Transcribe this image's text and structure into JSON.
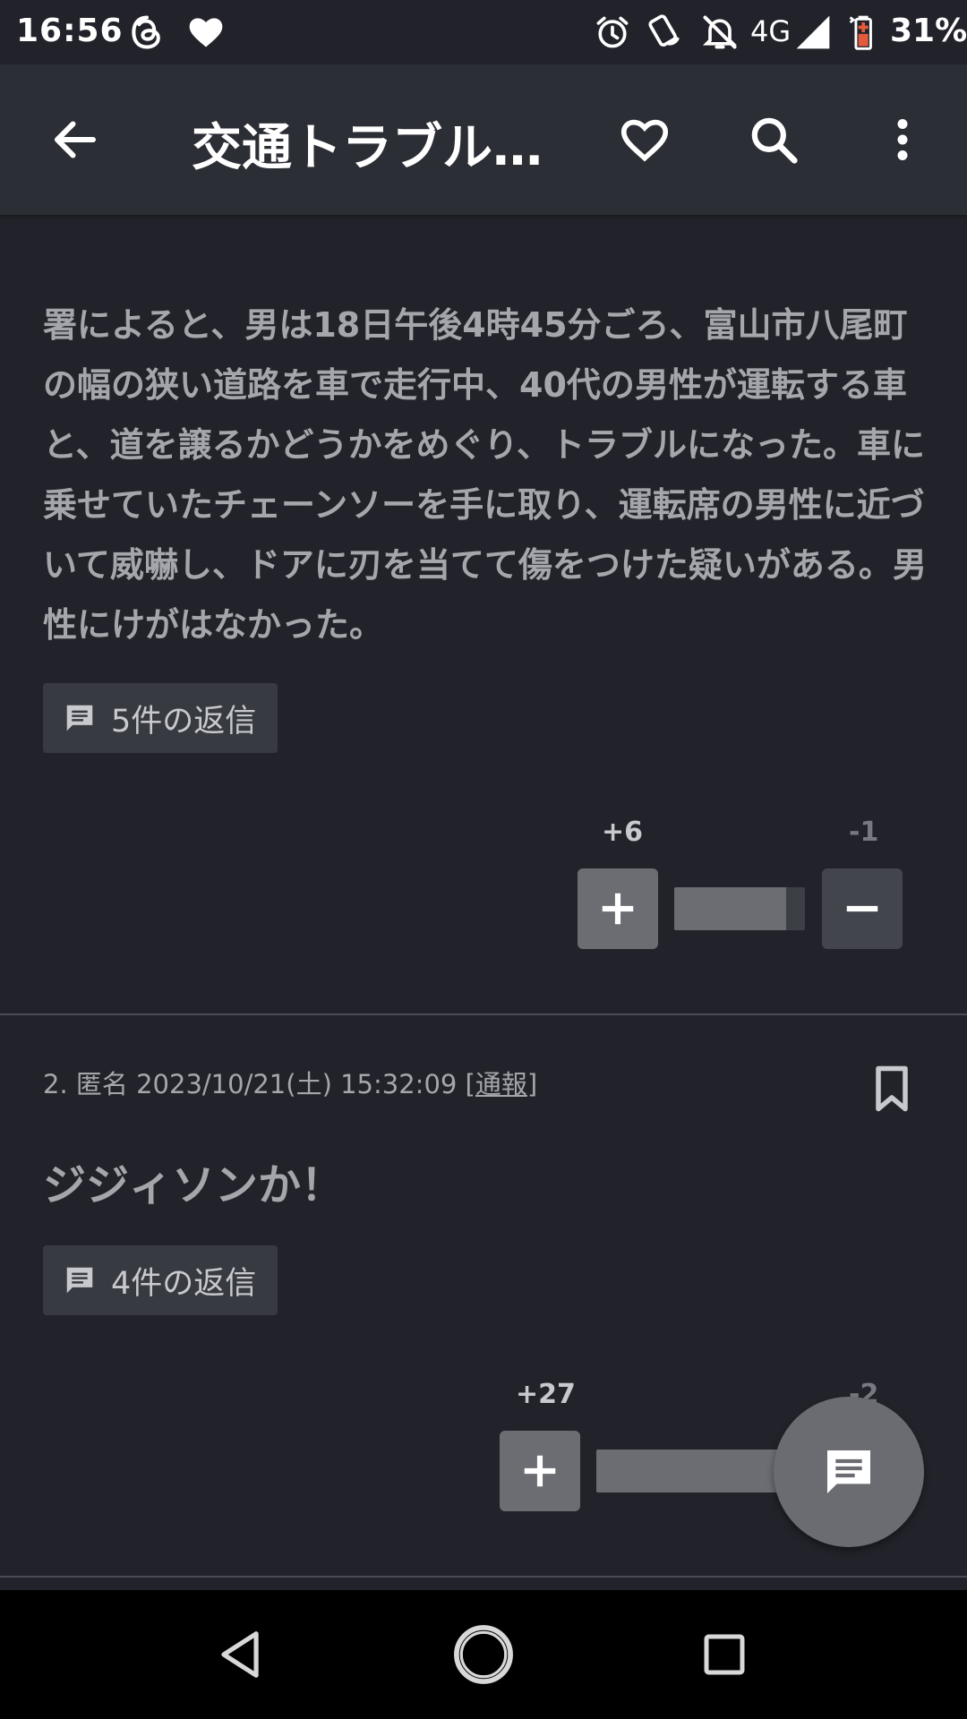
{
  "status_bar": {
    "time": "16:56",
    "network": "4G",
    "battery": "31%",
    "icons": [
      "threads-icon",
      "heart-icon",
      "alarm-icon",
      "nfc-icon",
      "mute-icon",
      "signal-icon",
      "battery-icon"
    ]
  },
  "app_bar": {
    "title": "交通トラブル…",
    "icons": [
      "back-arrow-icon",
      "heart-outline-icon",
      "search-icon",
      "more-vert-icon"
    ]
  },
  "post1": {
    "body": "署によると、男は18日午後4時45分ごろ、富山市八尾町の幅の狭い道路を車で走行中、40代の男性が運転する車と、道を譲るかどうかをめぐり、トラブルになった。車に乗せていたチェーンソーを手に取り、運転席の男性に近づいて威嚇し、ドアに刃を当てて傷をつけた疑いがある。男性にけがはなかった。",
    "replies_label": "5件の返信",
    "plus_count": "+6",
    "minus_count": "-1",
    "ratio": 0.857
  },
  "post2": {
    "meta": "2. 匿名 2023/10/21(土) 15:32:09 [",
    "report_label": "通報",
    "meta_close": "]",
    "body": "ジジィソンか！",
    "replies_label": "4件の返信",
    "plus_count": "+27",
    "minus_count": "-2",
    "ratio": 0.93
  },
  "colors": {
    "background": "#22232a",
    "app_bar": "#2c2e35",
    "plus_button": "#6b6d73",
    "minus_button": "#43454d",
    "fab": "#6a6c72"
  }
}
